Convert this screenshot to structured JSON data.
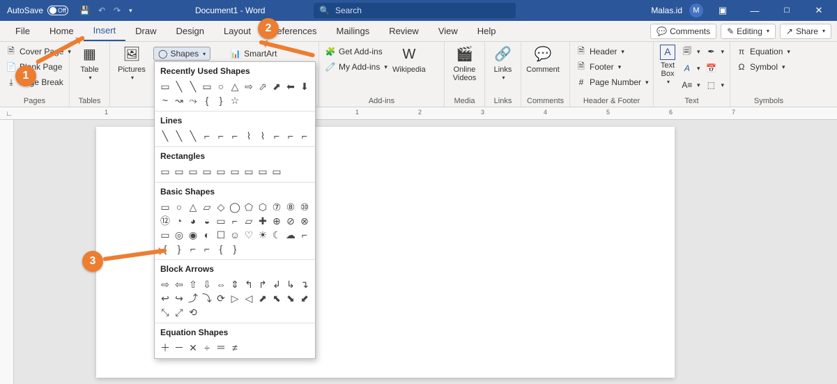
{
  "titlebar": {
    "autosave_label": "AutoSave",
    "autosave_state": "Off",
    "document_title": "Document1  -  Word",
    "search_placeholder": "Search",
    "username": "Malas.id",
    "avatar_initial": "M"
  },
  "tabs": {
    "items": [
      "File",
      "Home",
      "Insert",
      "Draw",
      "Design",
      "Layout",
      "References",
      "Mailings",
      "Review",
      "View",
      "Help"
    ],
    "active": "Insert",
    "right": {
      "comments": "Comments",
      "editing": "Editing",
      "share": "Share"
    }
  },
  "ribbon": {
    "pages": {
      "cover": "Cover Page",
      "blank": "Blank Page",
      "break": "Page Break",
      "label": "Pages"
    },
    "tables": {
      "table": "Table",
      "label": "Tables"
    },
    "illustrations": {
      "pictures": "Pictures",
      "shapes": "Shapes",
      "smartart": "SmartArt"
    },
    "addins": {
      "get": "Get Add-ins",
      "my": "My Add-ins",
      "wikipedia": "Wikipedia",
      "label": "Add-ins"
    },
    "media": {
      "video": "Online Videos",
      "label": "Media"
    },
    "links": {
      "links": "Links",
      "label": "Links"
    },
    "comments": {
      "comment": "Comment",
      "label": "Comments"
    },
    "headerfooter": {
      "header": "Header",
      "footer": "Footer",
      "pagenum": "Page Number",
      "label": "Header & Footer"
    },
    "text": {
      "textbox": "Text Box",
      "label": "Text"
    },
    "symbols": {
      "equation": "Equation",
      "symbol": "Symbol",
      "label": "Symbols"
    }
  },
  "shapes_popup": {
    "sections": [
      {
        "title": "Recently Used Shapes",
        "rows": [
          "▭ ╲ ╲ ▭ ○ △ ⇨ ⬀ ⬈ ⬅ ⬇",
          "~ ↝ ⤳ { } ☆"
        ]
      },
      {
        "title": "Lines",
        "rows": [
          "╲ ╲ ╲ ⌐ ⌐ ⌐ ⌇ ⌇ ⌐ ⌐ ⌐"
        ]
      },
      {
        "title": "Rectangles",
        "rows": [
          "▭ ▭ ▭ ▭ ▭ ▭ ▭ ▭ ▭"
        ]
      },
      {
        "title": "Basic Shapes",
        "rows": [
          "▭ ○ △ ▱ ◇ ◯ ⬠ ⬡ ⑦ ⑧ ⑩",
          "⑫ ◔ ◕ ◒ ▭ ⌐ ▱ ✚ ⊕ ⊘ ⊗",
          "▭ ◎ ◉ ◐ ☐ ☺ ♡ ☀ ☾ ☁",
          "⌐ { } ⌐ ⌐ { }"
        ]
      },
      {
        "title": "Block Arrows",
        "rows": [
          "⇨ ⇦ ⇧ ⇩ ⇔ ⇕ ↰ ↱ ↲ ↳ ↴",
          "↩ ↪ ⤴ ⤵ ⟳ ▷ ◁ ⬈ ⬉ ⬊ ⬋",
          "⤡ ⤢ ⟲"
        ]
      },
      {
        "title": "Equation Shapes",
        "rows": [
          "＋ － ✕ ÷ ＝ ≠"
        ]
      }
    ]
  },
  "ruler": {
    "marks": [
      "1",
      "",
      "1",
      "2",
      "3",
      "4",
      "5",
      "6",
      "7"
    ]
  },
  "callouts": {
    "c1": "1",
    "c2": "2",
    "c3": "3"
  }
}
